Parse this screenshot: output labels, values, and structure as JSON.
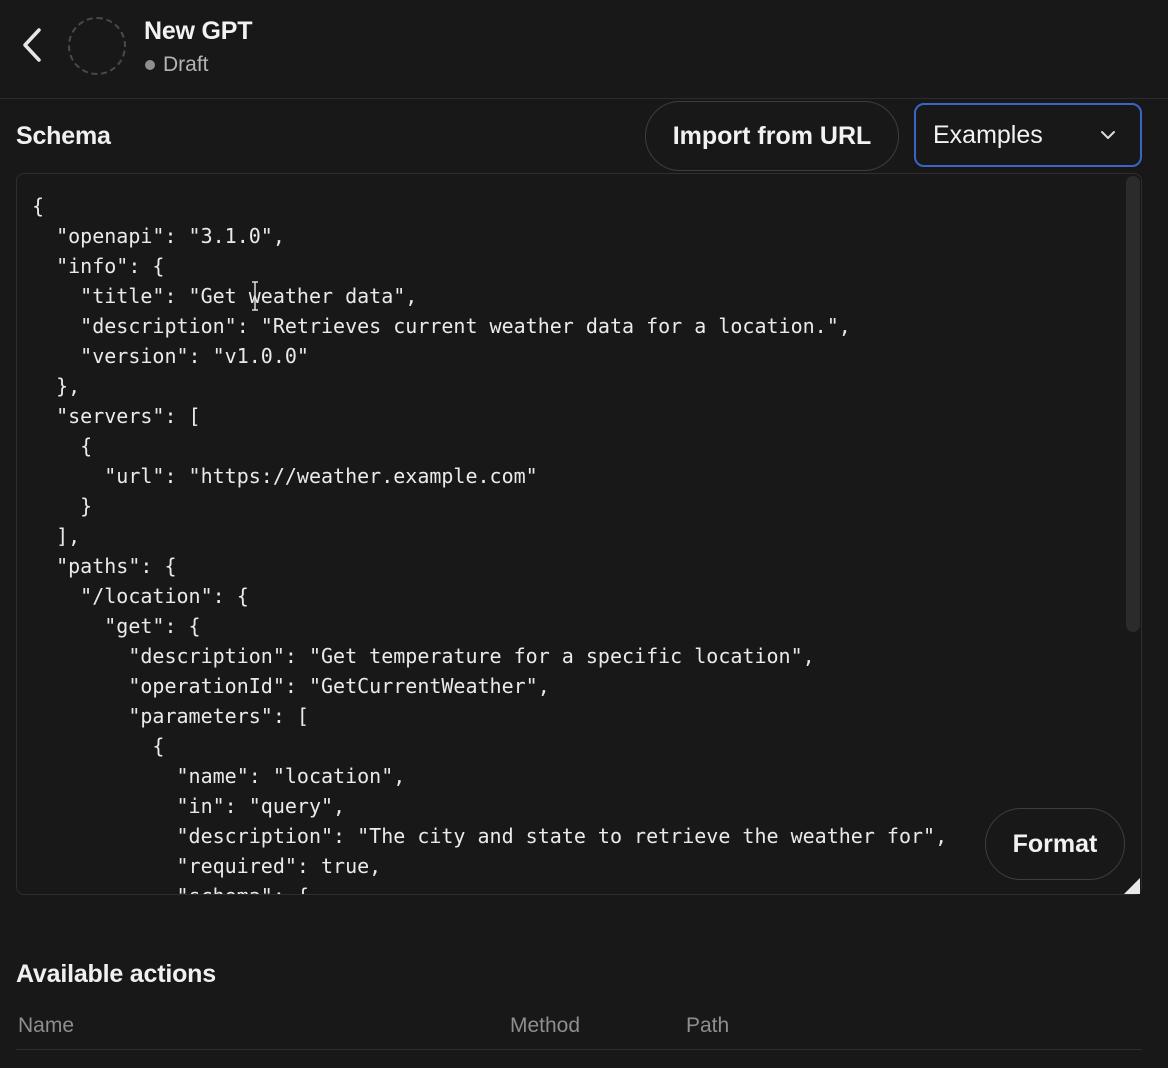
{
  "header": {
    "title": "New GPT",
    "status": "Draft"
  },
  "schema": {
    "label": "Schema",
    "import_button": "Import from URL",
    "examples_select": "Examples",
    "format_button": "Format",
    "code_lines": [
      "{",
      "  \"openapi\": \"3.1.0\",",
      "  \"info\": {",
      "    \"title\": \"Get weather data\",",
      "    \"description\": \"Retrieves current weather data for a location.\",",
      "    \"version\": \"v1.0.0\"",
      "  },",
      "  \"servers\": [",
      "    {",
      "      \"url\": \"https://weather.example.com\"",
      "    }",
      "  ],",
      "  \"paths\": {",
      "    \"/location\": {",
      "      \"get\": {",
      "        \"description\": \"Get temperature for a specific location\",",
      "        \"operationId\": \"GetCurrentWeather\",",
      "        \"parameters\": [",
      "          {",
      "            \"name\": \"location\",",
      "            \"in\": \"query\",",
      "            \"description\": \"The city and state to retrieve the weather for\",",
      "            \"required\": true,",
      "            \"schema\": {"
    ]
  },
  "actions": {
    "label": "Available actions",
    "columns": [
      "Name",
      "Method",
      "Path"
    ]
  },
  "icons": {
    "back": "chevron-left-icon",
    "examples": "chevron-down-icon",
    "resize": "resize-handle-icon",
    "cursor": "text-cursor-icon"
  },
  "colors": {
    "background": "#181818",
    "focus_border": "#3a64c8"
  }
}
